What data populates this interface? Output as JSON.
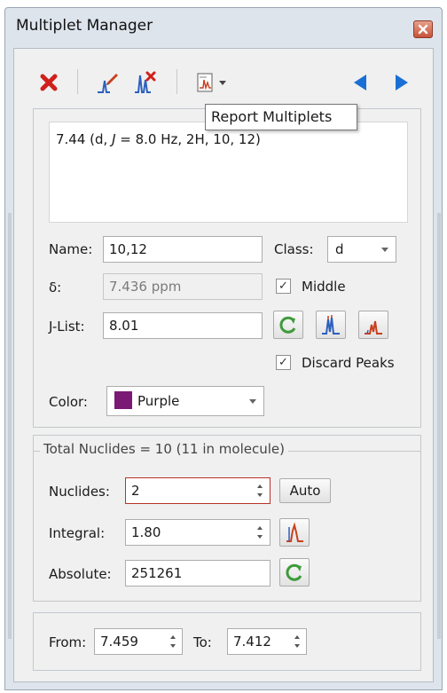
{
  "window": {
    "title": "Multiplet Manager"
  },
  "tooltip": {
    "text": "Report Multiplets"
  },
  "report": {
    "prefix": "7.44 (d, ",
    "j_symbol": "J",
    "suffix": " = 8.0 Hz, 2H, 10, 12)"
  },
  "form": {
    "name_label": "Name:",
    "name_value": "10,12",
    "class_label": "Class:",
    "class_value": "d",
    "delta_label": "δ:",
    "delta_value": "7.436 ppm",
    "middle_label": "Middle",
    "middle_checked": true,
    "jlist_label": "J-List:",
    "jlist_value": "8.01",
    "discard_label": "Discard Peaks",
    "discard_checked": true,
    "color_label": "Color:",
    "color_value": "Purple",
    "color_swatch": "#7b1a74"
  },
  "nuclides": {
    "legend": "Total Nuclides = 10 (11 in molecule)",
    "nuclides_label": "Nuclides:",
    "nuclides_value": "2",
    "auto_label": "Auto",
    "integral_label": "Integral:",
    "integral_value": "1.80",
    "absolute_label": "Absolute:",
    "absolute_value": "251261"
  },
  "range": {
    "from_label": "From:",
    "from_value": "7.459",
    "to_label": "To:",
    "to_value": "7.412"
  },
  "colors": {
    "delete_red": "#d0201c",
    "nav_blue": "#1a6fd6",
    "refresh_green": "#3f9a3a",
    "spectrum_blue": "#2c5fbd",
    "spectrum_red": "#c8401e"
  },
  "icons": [
    "delete-icon",
    "edit-multiplet-icon",
    "delete-multiplet-icon",
    "report-multiplets-icon",
    "previous-icon",
    "next-icon",
    "refresh-icon",
    "spectrum-icon",
    "close-icon"
  ]
}
